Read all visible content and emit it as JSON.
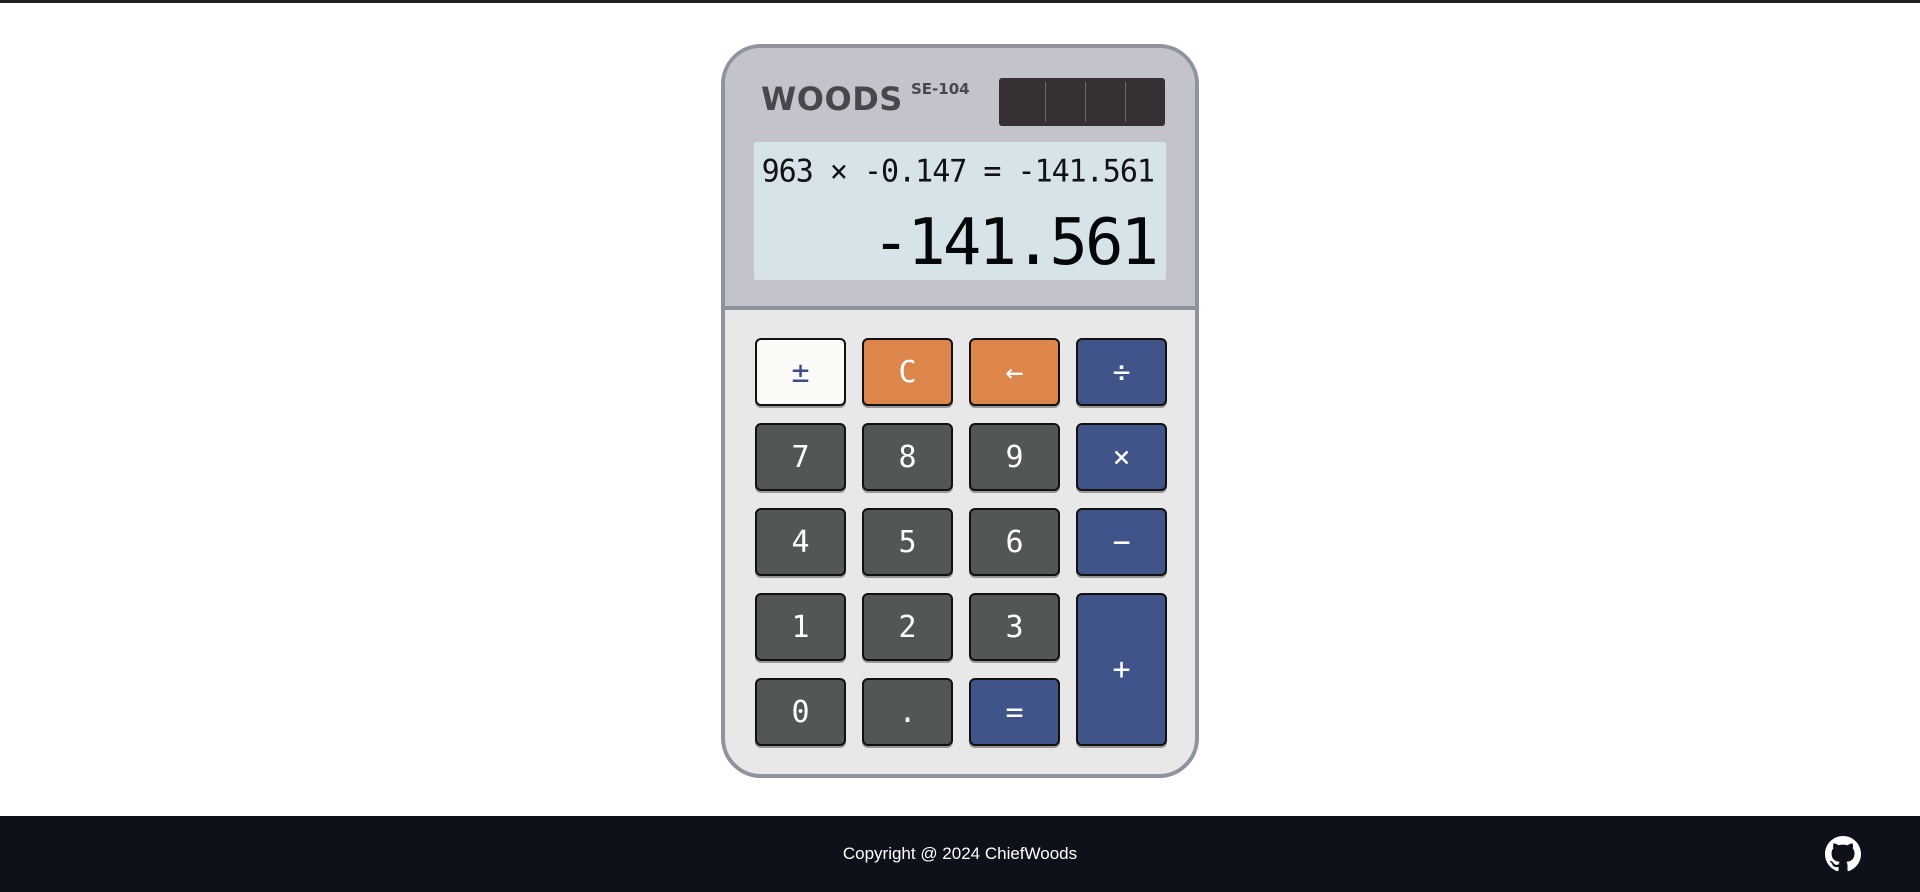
{
  "calculator": {
    "brand": "WOODS",
    "model": "SE-104",
    "display": {
      "expression": "963 × -0.147 = -141.561",
      "result": "-141.561"
    },
    "keys": {
      "sign": "±",
      "clear": "C",
      "backspace": "←",
      "divide": "÷",
      "seven": "7",
      "eight": "8",
      "nine": "9",
      "multiply": "×",
      "four": "4",
      "five": "5",
      "six": "6",
      "subtract": "−",
      "one": "1",
      "two": "2",
      "three": "3",
      "add": "+",
      "zero": "0",
      "decimal": ".",
      "equals": "="
    },
    "colors": {
      "body": "#e8e8e8",
      "head": "#c2c3cb",
      "border": "#8e939d",
      "display": "#d6e3e8",
      "key_dark": "#525656",
      "key_orange": "#dc864c",
      "key_blue": "#41548a",
      "key_light": "#fbfaf6"
    }
  },
  "footer": {
    "copyright": "Copyright @ 2024 ChiefWoods",
    "icon": "github-icon",
    "background": "#0e111a"
  }
}
